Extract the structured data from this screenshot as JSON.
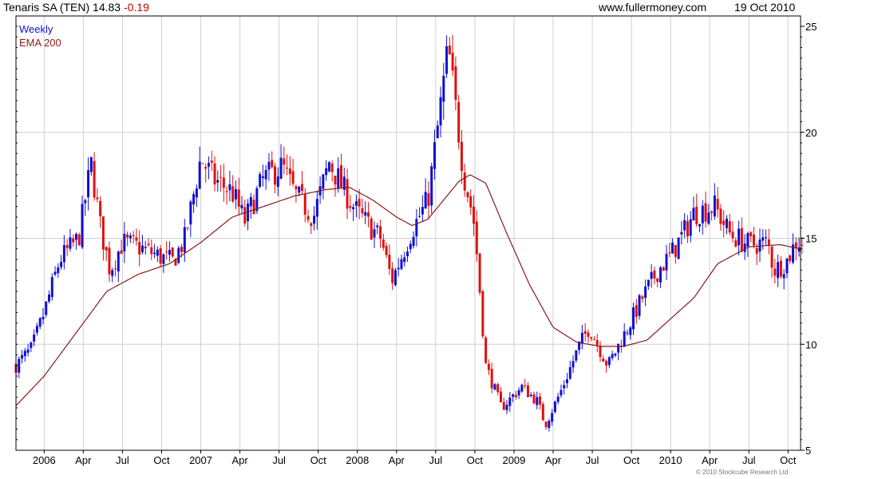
{
  "header": {
    "title": "Tenaris SA (TEN) 14.83",
    "change": "-0.19",
    "site": "www.fullermoney.com",
    "date": "19 Oct 2010"
  },
  "legend": {
    "series1": "Weekly",
    "series2": "EMA 200"
  },
  "copyright": "© 2010 Stockcube Research Ltd",
  "colors": {
    "up": "#1010d0",
    "down": "#e01010",
    "ema": "#8b1a1a",
    "grid": "#d0d0d0",
    "axis": "#000000"
  },
  "chart_data": {
    "type": "line",
    "title": "Tenaris SA (TEN) 14.83 -0.19",
    "ylim": [
      5,
      25
    ],
    "y_ticks": [
      5,
      10,
      15,
      20,
      25
    ],
    "y_tick_labels": [
      "5",
      "10",
      "15",
      "20",
      "25"
    ],
    "x_range": [
      2005.82,
      2010.83
    ],
    "x_ticks": [
      2006.0,
      2006.25,
      2006.5,
      2006.75,
      2007.0,
      2007.25,
      2007.5,
      2007.75,
      2008.0,
      2008.25,
      2008.5,
      2008.75,
      2009.0,
      2009.25,
      2009.5,
      2009.75,
      2010.0,
      2010.25,
      2010.5,
      2010.75
    ],
    "x_tick_labels": [
      "2006",
      "Apr",
      "Jul",
      "Oct",
      "2007",
      "Apr",
      "Jul",
      "Oct",
      "2008",
      "Apr",
      "Jul",
      "Oct",
      "2009",
      "Apr",
      "Jul",
      "Oct",
      "2010",
      "Apr",
      "Jul",
      "Oct"
    ],
    "grid": true,
    "legend_position": "top-left",
    "price_key_points": {
      "x": [
        2005.82,
        2005.92,
        2006.0,
        2006.1,
        2006.22,
        2006.3,
        2006.36,
        2006.42,
        2006.5,
        2006.6,
        2006.72,
        2006.82,
        2006.9,
        2007.0,
        2007.08,
        2007.2,
        2007.28,
        2007.4,
        2007.52,
        2007.6,
        2007.72,
        2007.82,
        2007.92,
        2008.0,
        2008.15,
        2008.22,
        2008.35,
        2008.45,
        2008.5,
        2008.58,
        2008.68,
        2008.74,
        2008.76,
        2008.82,
        2008.92,
        2009.05,
        2009.15,
        2009.2,
        2009.3,
        2009.42,
        2009.48,
        2009.6,
        2009.7,
        2009.82,
        2009.92,
        2010.0,
        2010.08,
        2010.15,
        2010.28,
        2010.38,
        2010.5,
        2010.62,
        2010.66,
        2010.74,
        2010.8
      ],
      "close": [
        9.0,
        9.8,
        11.5,
        14.0,
        15.0,
        18.5,
        15.5,
        13.5,
        14.8,
        14.6,
        14.2,
        13.9,
        15.0,
        18.8,
        17.8,
        17.2,
        15.8,
        17.8,
        18.4,
        17.1,
        16.0,
        18.6,
        17.2,
        16.2,
        15.0,
        13.0,
        15.4,
        16.8,
        19.5,
        24.0,
        18.0,
        16.0,
        14.5,
        9.0,
        7.0,
        8.0,
        7.3,
        6.2,
        7.8,
        10.0,
        10.8,
        9.0,
        10.4,
        12.2,
        13.5,
        14.2,
        15.2,
        16.2,
        16.5,
        15.2,
        14.7,
        14.8,
        13.5,
        13.9,
        14.83
      ]
    },
    "ema_key_points": {
      "x": [
        2005.82,
        2006.0,
        2006.2,
        2006.4,
        2006.6,
        2006.8,
        2007.0,
        2007.2,
        2007.4,
        2007.6,
        2007.8,
        2007.95,
        2008.1,
        2008.25,
        2008.35,
        2008.45,
        2008.55,
        2008.65,
        2008.72,
        2008.82,
        2008.95,
        2009.1,
        2009.25,
        2009.4,
        2009.55,
        2009.7,
        2009.85,
        2010.0,
        2010.15,
        2010.3,
        2010.5,
        2010.7,
        2010.83
      ],
      "value": [
        7.1,
        8.5,
        10.5,
        12.5,
        13.3,
        13.8,
        14.8,
        16.0,
        16.5,
        17.0,
        17.3,
        17.4,
        16.8,
        16.0,
        15.6,
        15.9,
        16.8,
        17.7,
        18.0,
        17.6,
        15.3,
        12.8,
        10.8,
        10.1,
        9.9,
        9.9,
        10.2,
        11.2,
        12.2,
        13.8,
        14.6,
        14.7,
        14.5
      ]
    }
  }
}
